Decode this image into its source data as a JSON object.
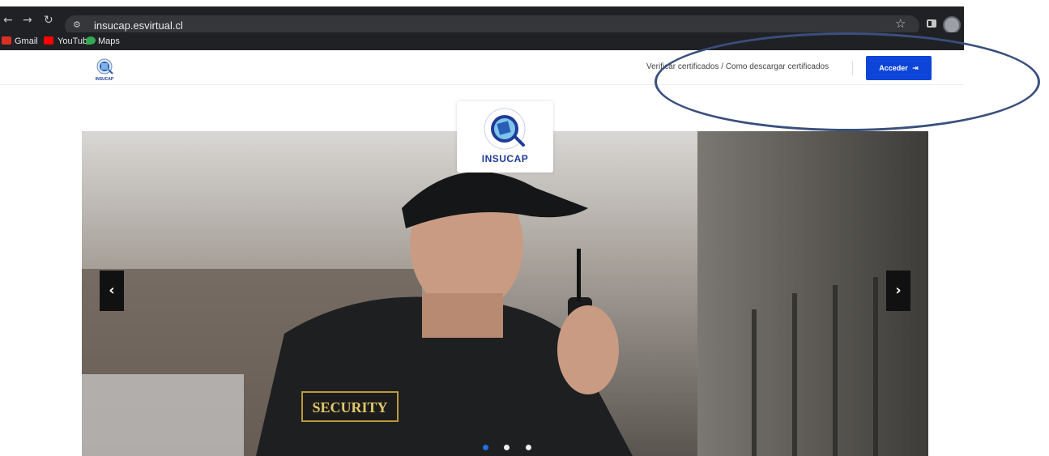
{
  "browser": {
    "url": "insucap.esvirtual.cl",
    "bookmarks": [
      {
        "label": "Gmail"
      },
      {
        "label": "YouTube"
      },
      {
        "label": "Maps"
      }
    ]
  },
  "header": {
    "nav_text": "Verificar certificados / Como descargar certificados",
    "login_label": "Acceder",
    "brand_name": "INSUCAP"
  },
  "logo_card": {
    "brand": "INSUCAP"
  },
  "hero": {
    "badge_text": "SECURITY",
    "prev_arrow": "‹",
    "next_arrow": "›",
    "slide_count": 3,
    "active_slide": 1
  },
  "colors": {
    "accent": "#0d45d8",
    "brand": "#1f3c99",
    "active_dot": "#1f6fe6",
    "annotation": "#3a4f7e"
  }
}
